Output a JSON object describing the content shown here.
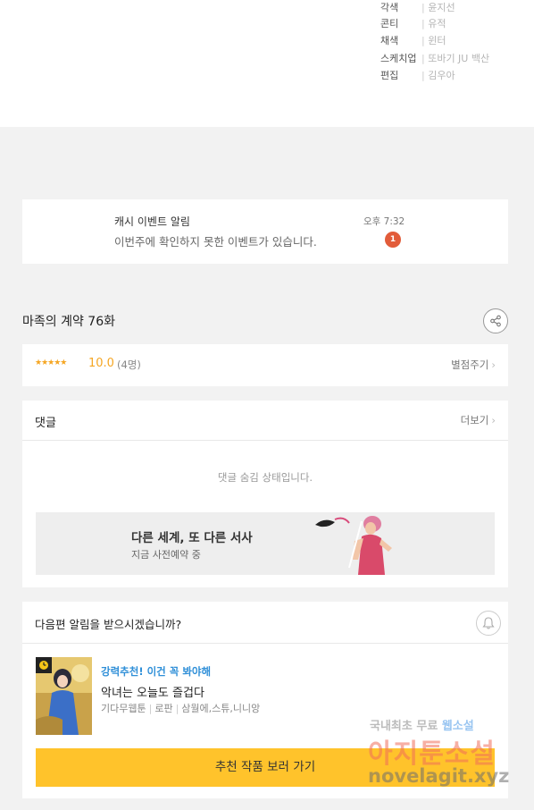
{
  "credits": [
    {
      "role": "각색",
      "value": "윤지선"
    },
    {
      "role": "콘티",
      "value": "유적"
    },
    {
      "role": "채색",
      "value": "윈터"
    },
    {
      "role": "스케치업",
      "value": "또바기  JU  백산"
    },
    {
      "role": "편집",
      "value": "김우아"
    }
  ],
  "notice": {
    "title": "캐시 이벤트 알림",
    "text": "이번주에 확인하지 못한 이벤트가 있습니다.",
    "time": "오후 7:32",
    "badge": "1"
  },
  "episode": {
    "title": "마족의 계약 76화"
  },
  "rating": {
    "stars": "★★★★★",
    "score": "10.0",
    "count": "(4명)",
    "rate_link": "별점주기"
  },
  "comments": {
    "title": "댓글",
    "more": "더보기",
    "hidden_text": "댓글 숨김 상태입니다.",
    "banner": {
      "title": "다른 세계, 또 다른 서사",
      "subtitle": "지금 사전예약 중"
    }
  },
  "next_episode": {
    "question": "다음편 알림을 받으시겠습니까?",
    "recommend_label": "강력추천! 이건 꼭 봐야해",
    "work_title": "악녀는 오늘도 즐겁다",
    "meta": [
      "기다무웹툰",
      "로판",
      "삼월에,스튜,니니앙"
    ],
    "button": "추천 작품 보러 가기"
  },
  "watermark": {
    "line1_a": "국내최초 무료 ",
    "line1_b": "웹소설",
    "line2": "아지툰소설",
    "line3": "novelagit.xyz"
  },
  "colors": {
    "accent_star": "#f5a623",
    "badge": "#e25c3a",
    "recommend_blue": "#2f8fd8",
    "button_yellow": "#ffc32b"
  }
}
